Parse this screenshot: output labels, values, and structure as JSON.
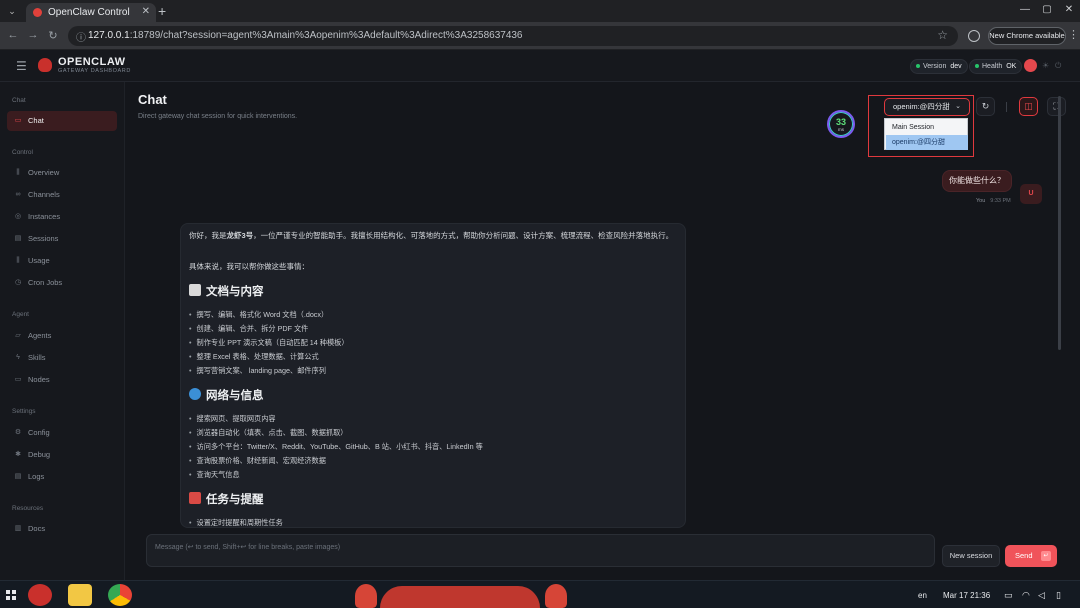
{
  "browser": {
    "tab_title": "OpenClaw Control",
    "url_host": "127.0.0.1",
    "url_rest": ":18789/chat?session=agent%3Amain%3Aopenim%3Adefault%3Adirect%3A3258637436",
    "update_chip": "New Chrome available"
  },
  "header": {
    "brand": "OPENCLAW",
    "brand_sub": "GATEWAY DASHBOARD",
    "version_label": "Version",
    "version_value": "dev",
    "health_label": "Health",
    "health_value": "OK"
  },
  "sidebar": {
    "sections": [
      {
        "label": "Chat",
        "items": [
          {
            "label": "Chat",
            "icon": "chat-bubble-icon",
            "active": true
          }
        ]
      },
      {
        "label": "Control",
        "items": [
          {
            "label": "Overview",
            "icon": "bar-chart-icon"
          },
          {
            "label": "Channels",
            "icon": "link-icon"
          },
          {
            "label": "Instances",
            "icon": "radio-icon"
          },
          {
            "label": "Sessions",
            "icon": "document-icon"
          },
          {
            "label": "Usage",
            "icon": "bar-chart-icon"
          },
          {
            "label": "Cron Jobs",
            "icon": "clock-icon"
          }
        ]
      },
      {
        "label": "Agent",
        "items": [
          {
            "label": "Agents",
            "icon": "folder-icon"
          },
          {
            "label": "Skills",
            "icon": "lightning-icon"
          },
          {
            "label": "Nodes",
            "icon": "monitor-icon"
          }
        ]
      },
      {
        "label": "Settings",
        "items": [
          {
            "label": "Config",
            "icon": "gear-icon"
          },
          {
            "label": "Debug",
            "icon": "bug-icon"
          },
          {
            "label": "Logs",
            "icon": "document-icon"
          }
        ]
      },
      {
        "label": "Resources",
        "items": [
          {
            "label": "Docs",
            "icon": "book-icon"
          }
        ]
      }
    ]
  },
  "main": {
    "title": "Chat",
    "subtitle": "Direct gateway chat session for quick interventions.",
    "latency_value": "33",
    "latency_unit": "ms",
    "session_selected": "openim:@四分甜",
    "session_options": [
      "Main Session",
      "openim:@四分甜"
    ]
  },
  "messages": {
    "user_text": "你能做些什么？",
    "user_name": "You",
    "user_time": "9:33 PM",
    "user_avatar": "U",
    "assistant": {
      "intro_a": "你好，我是",
      "intro_name": "龙虾3号",
      "intro_b": "，一位严谨专业的智能助手。我擅长用结构化、可落地的方式，帮助你分析问题、设计方案、梳理流程、检查风险并落地执行。",
      "lead": "具体来说，我可以帮你做这些事情：",
      "sections": [
        {
          "heading": "文档与内容",
          "items": [
            "撰写、编辑、格式化 Word 文档（.docx）",
            "创建、编辑、合并、拆分 PDF 文件",
            "制作专业 PPT 演示文稿（自动匹配 14 种模板）",
            "整理 Excel 表格、处理数据、计算公式",
            "撰写营销文案、 landing page、邮件序列"
          ]
        },
        {
          "heading": "网络与信息",
          "items": [
            "搜索网页、提取网页内容",
            "浏览器自动化（填表、点击、截图、数据抓取）",
            "访问多个平台：Twitter/X、Reddit、YouTube、GitHub、B 站、小红书、抖音、LinkedIn 等",
            "查询股票价格、财经新闻、宏观经济数据",
            "查询天气信息"
          ]
        },
        {
          "heading": "任务与提醒",
          "items": [
            "设置定时提醒和周期性任务"
          ]
        }
      ]
    }
  },
  "composer": {
    "placeholder": "Message (↩ to send, Shift+↩ for line breaks, paste images)",
    "new_session": "New session",
    "send": "Send"
  },
  "taskbar": {
    "lang": "en",
    "datetime": "Mar 17  21:36"
  },
  "colors": {
    "accent": "#e5484d",
    "background": "#14161b",
    "highlight": "#e0393e"
  }
}
